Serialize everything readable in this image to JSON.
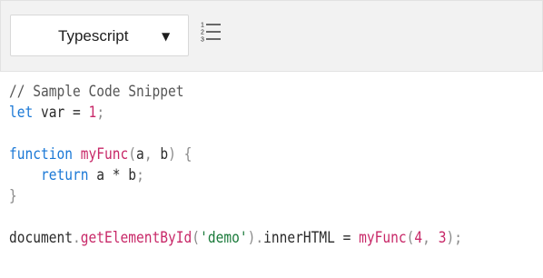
{
  "toolbar": {
    "language": {
      "selected": "Typescript",
      "caret_icon": "triangle-down-icon"
    },
    "line_numbers_icon": "ordered-list-icon",
    "line_numbers_digits": [
      "1",
      "2",
      "3"
    ]
  },
  "colors": {
    "keyword": "#1a78d6",
    "function": "#c82868",
    "number": "#c82868",
    "string": "#1a7a3a",
    "comment": "#555555",
    "punctuation": "#8a8a8a",
    "toolbar_bg": "#f2f2f2"
  },
  "code": {
    "lines": [
      [
        {
          "t": "comment",
          "v": "// Sample Code Snippet"
        }
      ],
      [
        {
          "t": "keyword",
          "v": "let"
        },
        {
          "t": "ident",
          "v": " var "
        },
        {
          "t": "op",
          "v": "="
        },
        {
          "t": "ident",
          "v": " "
        },
        {
          "t": "number",
          "v": "1"
        },
        {
          "t": "punct",
          "v": ";"
        }
      ],
      [],
      [
        {
          "t": "keyword",
          "v": "function"
        },
        {
          "t": "ident",
          "v": " "
        },
        {
          "t": "func",
          "v": "myFunc"
        },
        {
          "t": "punct",
          "v": "("
        },
        {
          "t": "ident",
          "v": "a"
        },
        {
          "t": "punct",
          "v": ","
        },
        {
          "t": "ident",
          "v": " b"
        },
        {
          "t": "punct",
          "v": ")"
        },
        {
          "t": "ident",
          "v": " "
        },
        {
          "t": "punct",
          "v": "{"
        }
      ],
      [
        {
          "t": "ident",
          "v": "    "
        },
        {
          "t": "keyword",
          "v": "return"
        },
        {
          "t": "ident",
          "v": " a "
        },
        {
          "t": "op",
          "v": "*"
        },
        {
          "t": "ident",
          "v": " b"
        },
        {
          "t": "punct",
          "v": ";"
        }
      ],
      [
        {
          "t": "punct",
          "v": "}"
        }
      ],
      [],
      [
        {
          "t": "ident",
          "v": "document"
        },
        {
          "t": "punct",
          "v": "."
        },
        {
          "t": "member",
          "v": "getElementById"
        },
        {
          "t": "punct",
          "v": "("
        },
        {
          "t": "string",
          "v": "'demo'"
        },
        {
          "t": "punct",
          "v": ")."
        },
        {
          "t": "ident",
          "v": "innerHTML "
        },
        {
          "t": "op",
          "v": "="
        },
        {
          "t": "ident",
          "v": " "
        },
        {
          "t": "func",
          "v": "myFunc"
        },
        {
          "t": "punct",
          "v": "("
        },
        {
          "t": "number",
          "v": "4"
        },
        {
          "t": "punct",
          "v": ","
        },
        {
          "t": "ident",
          "v": " "
        },
        {
          "t": "number",
          "v": "3"
        },
        {
          "t": "punct",
          "v": ");"
        }
      ]
    ]
  }
}
